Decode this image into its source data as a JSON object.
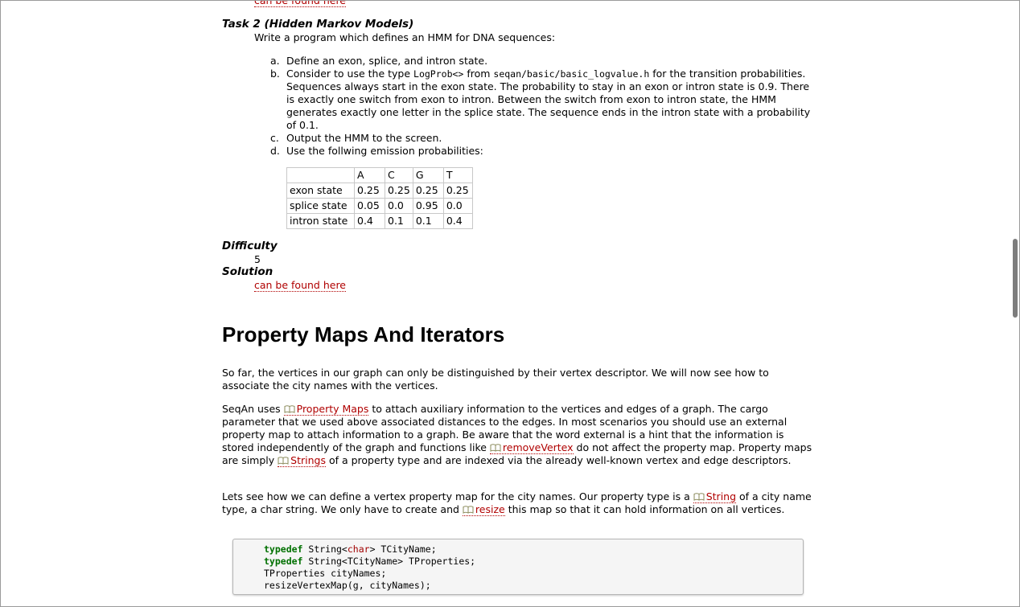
{
  "top_link": "can be found here",
  "task": {
    "title": "Task 2 (Hidden Markov Models)",
    "intro": "Write a program which defines an HMM for DNA sequences:",
    "steps": [
      {
        "label": "a.",
        "text": "Define an exon, splice, and intron state."
      },
      {
        "label": "b.",
        "pre": "Consider to use the type ",
        "code1": "LogProb<>",
        "mid": " from ",
        "code2": "seqan/basic/basic_logvalue.h",
        "post": " for the transition probabilities. Sequences always start in the exon state. The probability to stay in an exon or intron state is 0.9. There is exactly one switch from exon to intron. Between the switch from exon to intron state, the HMM generates exactly one letter in the splice state. The sequence ends in the intron state with a probability of 0.1."
      },
      {
        "label": "c.",
        "text": "Output the HMM to the screen."
      },
      {
        "label": "d.",
        "text": "Use the follwing emission probabilities:"
      }
    ],
    "table": {
      "header": [
        "",
        "A",
        "C",
        "G",
        "T"
      ],
      "rows": [
        [
          "exon state",
          "0.25",
          "0.25",
          "0.25",
          "0.25"
        ],
        [
          "splice state",
          "0.05",
          "0.0",
          "0.95",
          "0.0"
        ],
        [
          "intron state",
          "0.4",
          "0.1",
          "0.1",
          "0.4"
        ]
      ]
    },
    "difficulty_label": "Difficulty",
    "difficulty_value": "5",
    "solution_label": "Solution",
    "solution_link": "can be found here"
  },
  "section": {
    "title": "Property Maps And Iterators",
    "p1": "So far, the vertices in our graph can only be distinguished by their vertex descriptor. We will now see how to associate the city names with the vertices.",
    "p2": {
      "a": "SeqAn uses ",
      "link1": "Property Maps",
      "b": " to attach auxiliary information to the vertices and edges of a graph. The cargo parameter that we used above associated distances to the edges. In most scenarios you should use an external property map to attach information to a graph. Be aware that the word external is a hint that the information is stored independently of the graph and functions like ",
      "link2": "removeVertex",
      "c": " do not affect the property map. Property maps are simply ",
      "link3": "Strings",
      "d": " of a property type and are indexed via the already well-known vertex and edge descriptors."
    },
    "p3": {
      "a": "Lets see how we can define a vertex property map for the city names. Our property type is a ",
      "link1": "String",
      "b": " of a city name type, a char string. We only have to create and ",
      "link2": "resize",
      "c": " this map so that it can hold information on all vertices."
    }
  },
  "code": {
    "line1": {
      "kw": "typedef",
      "a": " String<",
      "ty": "char",
      "b": "> TCityName;"
    },
    "line2": {
      "kw": "typedef",
      "a": " String<TCityName> TProperties;"
    },
    "line3": "TProperties cityNames;",
    "line4": "resizeVertexMap(g, cityNames);"
  }
}
